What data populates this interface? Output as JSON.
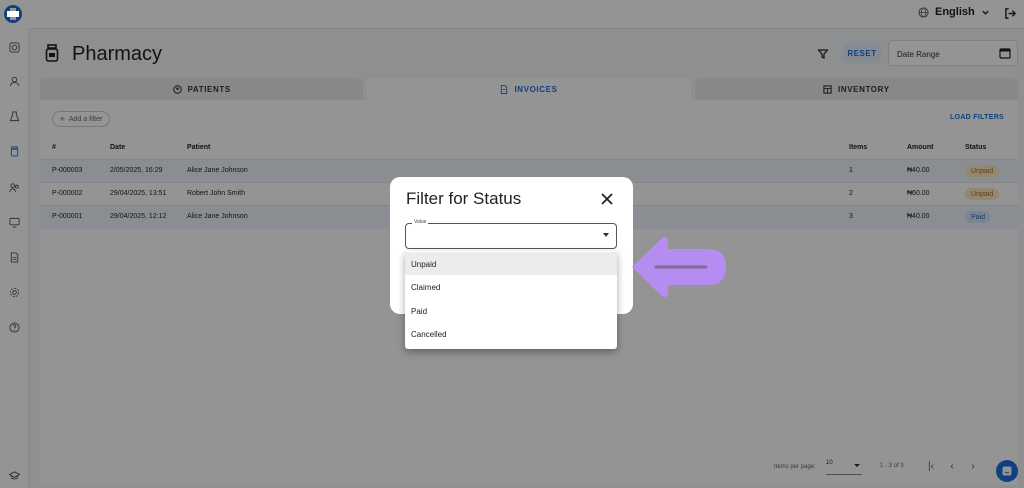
{
  "header": {
    "language": "English"
  },
  "page": {
    "title": "Pharmacy",
    "reset_label": "RESET",
    "date_range_placeholder": "Date Range"
  },
  "tabs": [
    {
      "label": "PATIENTS",
      "icon": "patients-icon"
    },
    {
      "label": "INVOICES",
      "icon": "invoice-icon"
    },
    {
      "label": "INVENTORY",
      "icon": "inventory-icon"
    }
  ],
  "toolbar": {
    "add_filter": "Add a filter",
    "load_filters": "LOAD FILTERS"
  },
  "table": {
    "headers": {
      "id": "#",
      "date": "Date",
      "patient": "Patient",
      "items": "Items",
      "amount": "Amount",
      "status": "Status"
    },
    "rows": [
      {
        "id": "P-000003",
        "date": "2/05/2025, 16:29",
        "patient": "Alice Jane Johnson",
        "items": "1",
        "amount": "₦40.00",
        "status": "Unpaid"
      },
      {
        "id": "P-000002",
        "date": "29/04/2025, 13:51",
        "patient": "Robert John Smith",
        "items": "2",
        "amount": "₦60.00",
        "status": "Unpaid"
      },
      {
        "id": "P-000001",
        "date": "29/04/2025, 12:12",
        "patient": "Alice Jane Johnson",
        "items": "3",
        "amount": "₦40.00",
        "status": "Paid"
      }
    ]
  },
  "pagination": {
    "items_per_page_label": "Items per page:",
    "items_per_page": "10",
    "range": "1 - 3 of 3"
  },
  "dialog": {
    "title": "Filter for Status",
    "field_label": "Value",
    "options": [
      "Unpaid",
      "Claimed",
      "Paid",
      "Cancelled"
    ],
    "highlighted_option": "Unpaid"
  },
  "colors": {
    "accent": "#1e6fd9",
    "arrow": "#b58cf0"
  }
}
